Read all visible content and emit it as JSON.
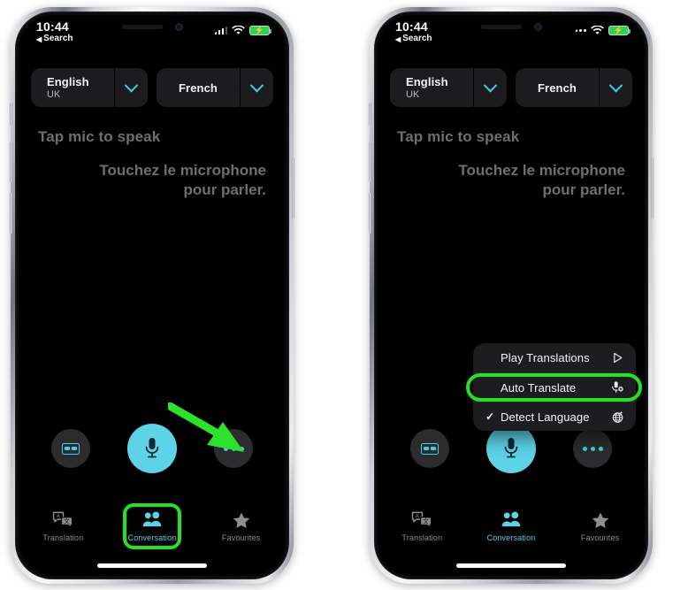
{
  "phones": [
    {
      "id": "left",
      "status_bar": {
        "time": "10:44",
        "back_label": "Search",
        "back_icon": "back-triangle-icon",
        "signal_icon": "cellular-bars-icon",
        "signal_style": "bars",
        "wifi_icon": "wifi-icon",
        "battery_icon": "battery-charging-icon",
        "battery_color": "#30d158"
      },
      "language_bar": {
        "source": {
          "main": "English",
          "sub": "UK",
          "chevron_icon": "chevron-down-icon"
        },
        "target": {
          "main": "French",
          "sub": "",
          "chevron_icon": "chevron-down-icon"
        }
      },
      "prompts": {
        "source_prompt": "Tap mic to speak",
        "target_prompt": "Touchez le microphone pour parler."
      },
      "controls": {
        "card_button_icon": "flashcard-icon",
        "mic_button_icon": "microphone-icon",
        "more_button_icon": "ellipsis-icon"
      },
      "tabs": [
        {
          "label": "Translation",
          "icon": "translate-bubbles-icon",
          "active": false,
          "highlighted": false
        },
        {
          "label": "Conversation",
          "icon": "people-icon",
          "active": true,
          "highlighted": true
        },
        {
          "label": "Favourites",
          "icon": "star-icon",
          "active": false,
          "highlighted": false
        }
      ],
      "menu": null,
      "annotation": {
        "arrow_icon": "green-arrow-icon",
        "arrow_color": "#2ee02e",
        "points_to": "more-button"
      }
    },
    {
      "id": "right",
      "status_bar": {
        "time": "10:44",
        "back_label": "Search",
        "back_icon": "back-triangle-icon",
        "signal_icon": "cellular-dots-icon",
        "signal_style": "dots",
        "wifi_icon": "wifi-icon",
        "battery_icon": "battery-charging-icon",
        "battery_color": "#30d158"
      },
      "language_bar": {
        "source": {
          "main": "English",
          "sub": "UK",
          "chevron_icon": "chevron-down-icon"
        },
        "target": {
          "main": "French",
          "sub": "",
          "chevron_icon": "chevron-down-icon"
        }
      },
      "prompts": {
        "source_prompt": "Tap mic to speak",
        "target_prompt": "Touchez le microphone pour parler."
      },
      "controls": {
        "card_button_icon": "flashcard-icon",
        "mic_button_icon": "microphone-icon",
        "more_button_icon": "ellipsis-icon"
      },
      "tabs": [
        {
          "label": "Translation",
          "icon": "translate-bubbles-icon",
          "active": false,
          "highlighted": false
        },
        {
          "label": "Conversation",
          "icon": "people-icon",
          "active": true,
          "highlighted": false
        },
        {
          "label": "Favourites",
          "icon": "star-icon",
          "active": false,
          "highlighted": false
        }
      ],
      "menu": {
        "items": [
          {
            "label": "Play Translations",
            "icon": "play-icon",
            "checked": false,
            "highlighted": false
          },
          {
            "label": "Auto Translate",
            "icon": "auto-mic-icon",
            "checked": false,
            "highlighted": true
          },
          {
            "label": "Detect Language",
            "icon": "globe-translate-icon",
            "checked": true,
            "highlighted": false
          }
        ]
      },
      "annotation": null
    }
  ],
  "colors": {
    "accent_cyan": "#5ed2e6",
    "highlight_green": "#25e025",
    "arrow_green": "#2ee02e",
    "panel_dark": "#1c1c1e",
    "screen_black": "#000000",
    "muted_text": "#6e6e73"
  }
}
